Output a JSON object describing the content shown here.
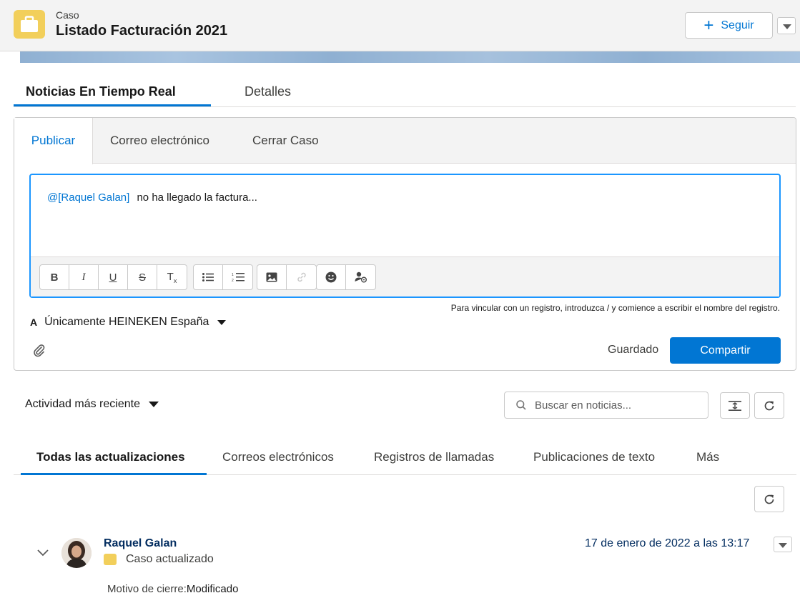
{
  "header": {
    "object_label": "Caso",
    "title": "Listado Facturación 2021",
    "follow_label": "Seguir",
    "icon": "briefcase-icon"
  },
  "main_tabs": [
    {
      "label": "Noticias En Tiempo Real",
      "active": true
    },
    {
      "label": "Detalles",
      "active": false
    }
  ],
  "publisher": {
    "tabs": [
      {
        "label": "Publicar",
        "active": true
      },
      {
        "label": "Correo electrónico",
        "active": false
      },
      {
        "label": "Cerrar Caso",
        "active": false
      }
    ],
    "mention": "@[Raquel Galan]",
    "message": "no ha llegado la factura...",
    "toolbar_icons": [
      "bold-icon",
      "italic-icon",
      "underline-icon",
      "strikethrough-icon",
      "clear-format-icon",
      "bullet-list-icon",
      "numbered-list-icon",
      "image-icon",
      "link-icon",
      "emoji-icon",
      "mention-user-icon"
    ],
    "hint": "Para vincular con un registro, introduzca / y comience a escribir el nombre del registro.",
    "audience_prefix": "A",
    "audience": "Únicamente HEINEKEN España",
    "saved_label": "Guardado",
    "share_label": "Compartir"
  },
  "feed": {
    "sort_label": "Actividad más reciente",
    "search_placeholder": "Buscar en noticias...",
    "filter_tabs": [
      {
        "label": "Todas las actualizaciones",
        "active": true
      },
      {
        "label": "Correos electrónicos",
        "active": false
      },
      {
        "label": "Registros de llamadas",
        "active": false
      },
      {
        "label": "Publicaciones de texto",
        "active": false
      },
      {
        "label": "Más",
        "active": false
      }
    ],
    "items": [
      {
        "author": "Raquel Galan",
        "subtitle": "Caso actualizado",
        "timestamp": "17 de enero de 2022 a las 13:17",
        "field_label": "Motivo de cierre:",
        "field_value": "Modificado"
      }
    ]
  },
  "colors": {
    "brand": "#0176d3",
    "case_icon": "#f2cf5b",
    "focus": "#1b96ff"
  }
}
